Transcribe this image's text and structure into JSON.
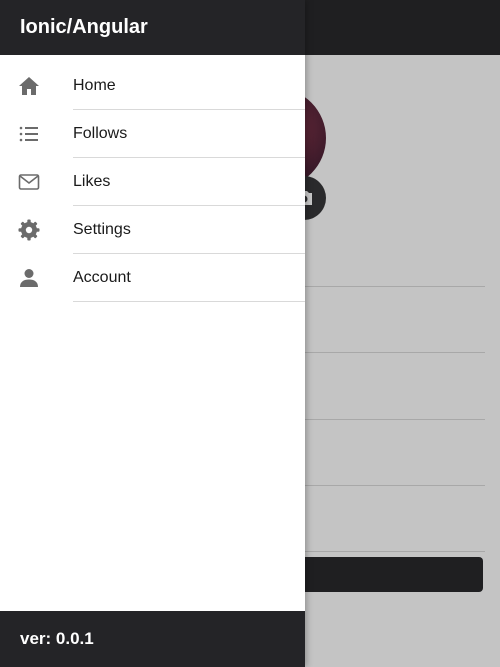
{
  "app": {
    "title": "Ionic/Angular"
  },
  "menu": {
    "items": [
      {
        "label": "Home",
        "icon": "home-icon"
      },
      {
        "label": "Follows",
        "icon": "list-icon"
      },
      {
        "label": "Likes",
        "icon": "mail-icon"
      },
      {
        "label": "Settings",
        "icon": "gear-icon"
      },
      {
        "label": "Account",
        "icon": "person-icon"
      }
    ]
  },
  "footer": {
    "version": "ver: 0.0.1"
  },
  "colors": {
    "header": "#242427",
    "menu_bg": "#ffffff",
    "icon": "#6b6b6b",
    "backdrop": "#c2c2c2"
  }
}
